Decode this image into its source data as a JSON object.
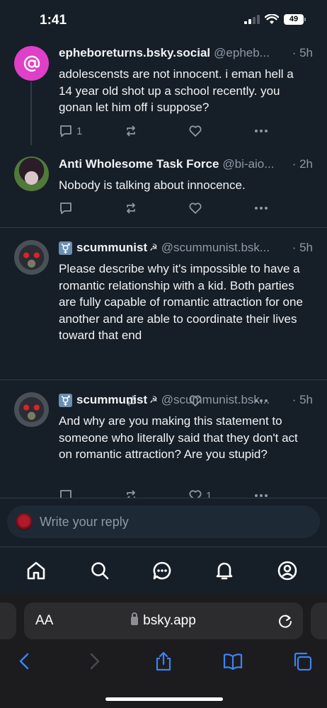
{
  "status_bar": {
    "time": "1:41",
    "battery": "49"
  },
  "posts": [
    {
      "display_name": "epheboreturns.bsky.social",
      "handle": "@epheb...",
      "time": "· 5h",
      "text": "adolescensts are not innocent. i eman hell  a 14 year old shot up a school recently. you gonan let him off i suppose?",
      "reply_count": "1",
      "repost_count": "",
      "like_count": ""
    },
    {
      "display_name": "Anti Wholesome Task Force",
      "handle": "@bi-aio...",
      "time": "· 2h",
      "text": "Nobody is talking about innocence.",
      "reply_count": "",
      "repost_count": "",
      "like_count": ""
    },
    {
      "display_name": "scummunist",
      "handle": "@scummunist.bsk...",
      "time": "· 5h",
      "text": "Please describe why it's impossible to have a romantic relationship with a kid. Both parties are fully capable of romantic attraction for one another and are able to coordinate their lives toward that end",
      "reply_count": "",
      "repost_count": "",
      "like_count": ""
    },
    {
      "display_name": "scummunist",
      "handle": "@scummunist.bsk...",
      "time": "· 5h",
      "text": "And why are you making this statement to someone who literally said that they don't act on romantic attraction? Are you stupid?",
      "reply_count": "",
      "repost_count": "",
      "like_count": "1"
    }
  ],
  "reply_bar": {
    "placeholder": "Write your reply"
  },
  "bottom_nav": [
    "home-icon",
    "search-icon",
    "chat-icon",
    "bell-icon",
    "profile-icon"
  ],
  "browser": {
    "aa_label": "AA",
    "url": "bsky.app"
  },
  "colors": {
    "background": "#161e27",
    "muted": "#8d99a6",
    "accent_avatar": "#e040c8",
    "divider": "#2e3c4a"
  }
}
